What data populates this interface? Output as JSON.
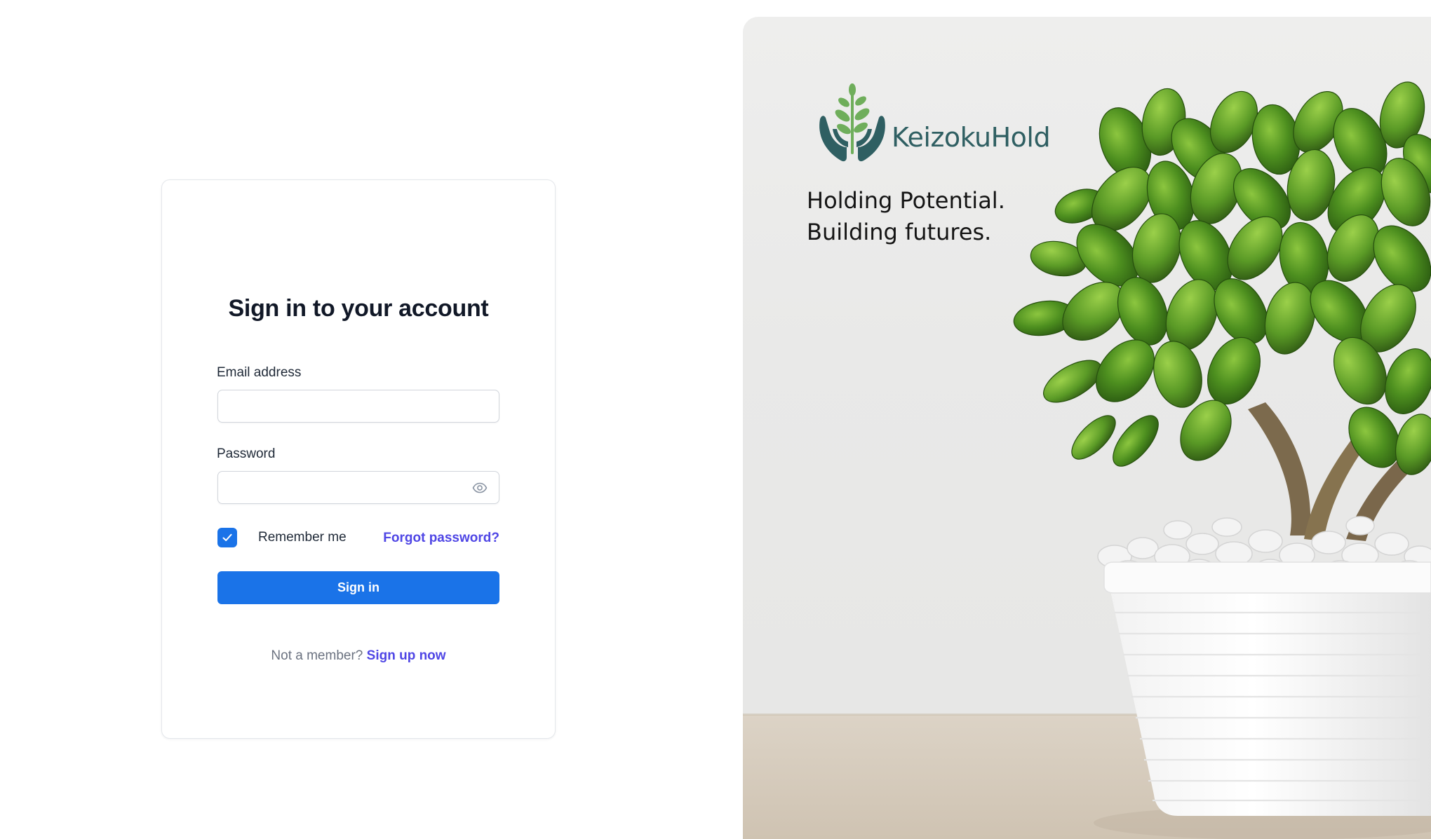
{
  "login": {
    "title": "Sign in to your account",
    "email": {
      "label": "Email address",
      "value": "",
      "placeholder": ""
    },
    "password": {
      "label": "Password",
      "value": "",
      "placeholder": "",
      "toggle_icon": "eye-icon"
    },
    "remember": {
      "label": "Remember me",
      "checked": true
    },
    "forgot_label": "Forgot password?",
    "submit_label": "Sign in",
    "signup_prompt": "Not a member?",
    "signup_link": "Sign up now"
  },
  "brand": {
    "name": "KeizokuHold",
    "logo_icon": "sprout-in-hands-logo",
    "tagline_line1": "Holding Potential.",
    "tagline_line2": "Building futures."
  },
  "colors": {
    "primary": "#1a73e8",
    "link": "#4f46e5",
    "heading": "#111827",
    "brand_teal": "#2f5f62",
    "brand_green": "#6fae5b"
  }
}
